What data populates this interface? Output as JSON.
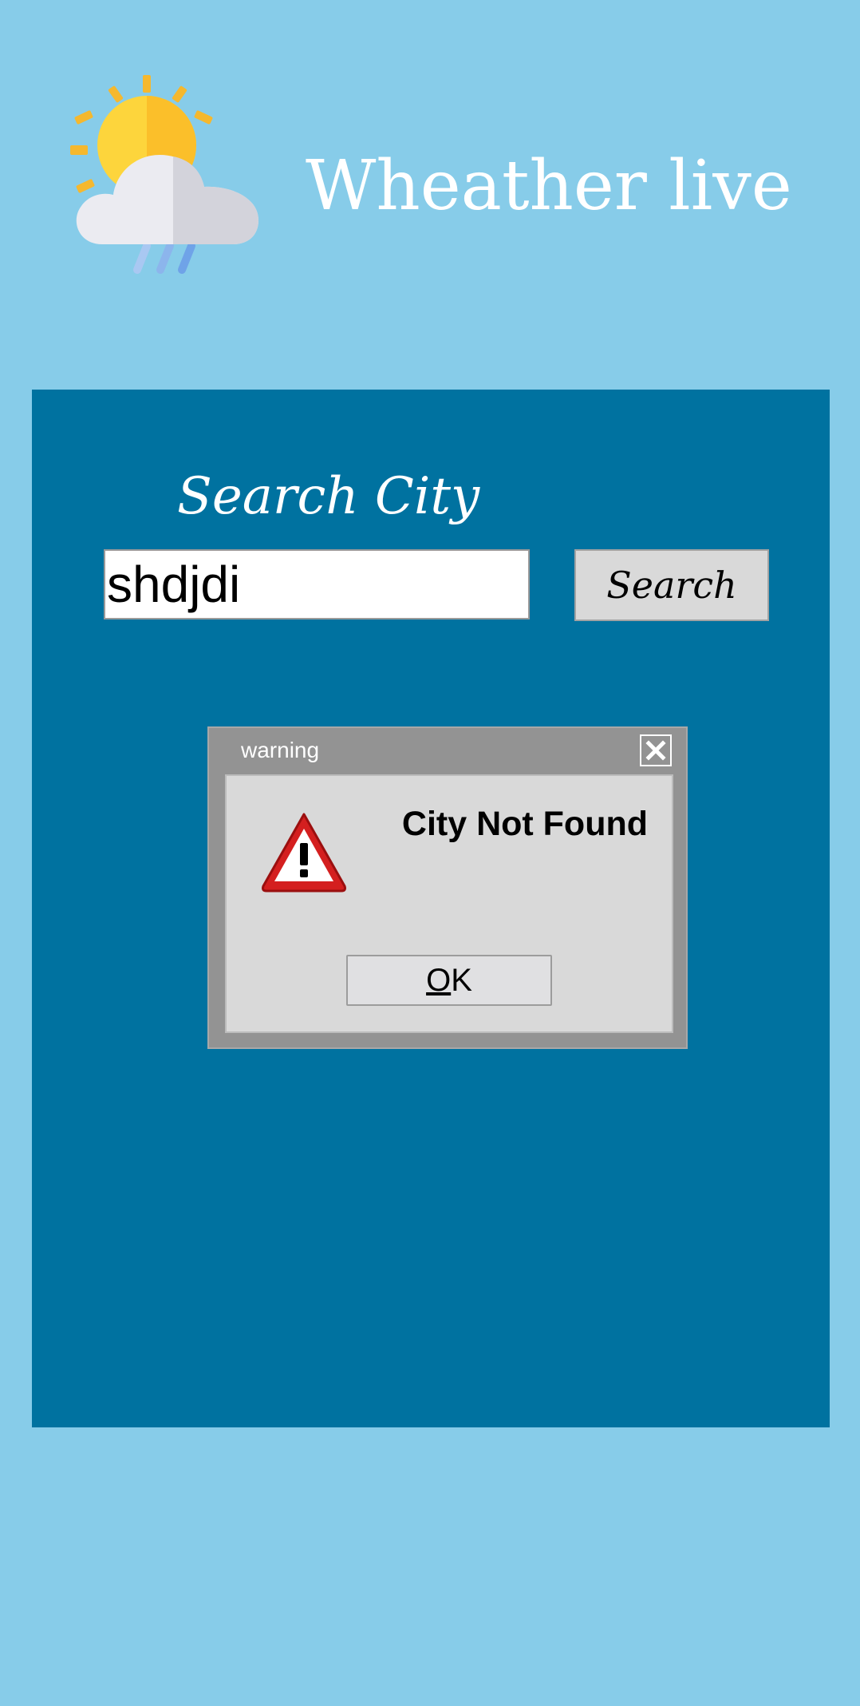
{
  "header": {
    "title": "Wheather live",
    "logo_icon": "weather-sun-cloud-rain-icon"
  },
  "search": {
    "label": "Search City",
    "input_value": "shdjdi",
    "button_label": "Search"
  },
  "dialog": {
    "title": "warning",
    "message": "City Not Found",
    "ok_mnemonic": "O",
    "ok_rest": "K",
    "icon": "warning-triangle-icon",
    "close_icon": "close-icon"
  },
  "colors": {
    "background": "#87CCE9",
    "panel": "#0072A0",
    "dialog_frame": "#939393",
    "dialog_body": "#D9D9D9"
  }
}
